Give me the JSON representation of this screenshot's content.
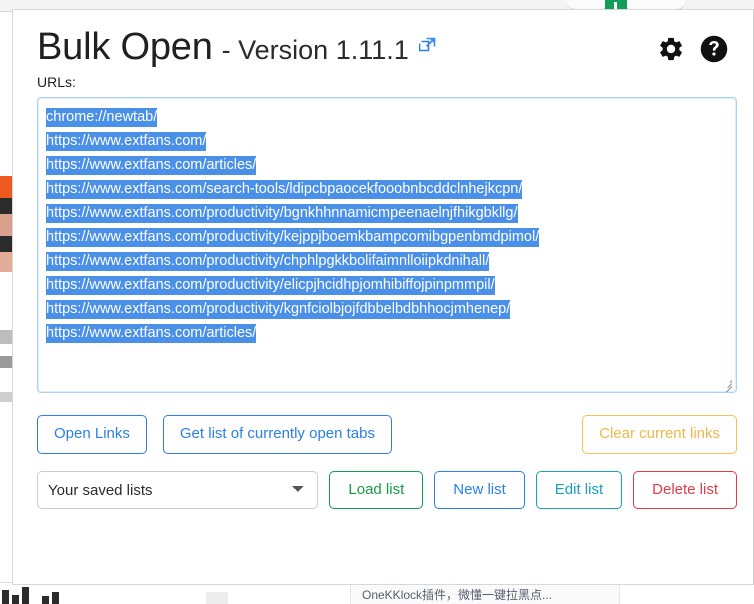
{
  "background": {
    "bottom_card_text": "OneKKlock插件，微懂一键拉黑点..."
  },
  "popup": {
    "title": "Bulk Open",
    "version": "- Version 1.11.1",
    "external_link_icon": "external-link-icon",
    "settings_icon": "gear-icon",
    "help_icon": "help-circle-icon",
    "urls_label": "URLs:",
    "textarea": {
      "placeholder": "",
      "all_selected": true,
      "lines": [
        "chrome://newtab/",
        "https://www.extfans.com/",
        "https://www.extfans.com/articles/",
        "https://www.extfans.com/search-tools/ldipcbpaocekfooobnbcddclnhejkcpn/",
        "https://www.extfans.com/productivity/bgnkhhnnamicmpeenaelnjfhikgbkllg/",
        "https://www.extfans.com/productivity/kejppjboemkbampcomibgpenbmdpimol/",
        "https://www.extfans.com/productivity/chphlpgkkbolifaimnlloiipkdnihall/",
        "https://www.extfans.com/productivity/elicpjhcidhpjomhibiffojpinpmmpil/",
        "https://www.extfans.com/productivity/kgnfciolbjojfdbbelbdbhhocjmhenep/",
        "https://www.extfans.com/articles/"
      ]
    },
    "actions": {
      "open_links": "Open Links",
      "get_open_tabs": "Get list of currently open tabs",
      "clear_links": "Clear current links"
    },
    "saved_lists": {
      "selected": "Your saved lists",
      "options": [
        "Your saved lists"
      ],
      "load": "Load list",
      "new": "New list",
      "edit": "Edit list",
      "delete": "Delete list"
    },
    "colors": {
      "primary_blue": "#2a7fe8",
      "selection_blue": "#4a90e8",
      "amber": "#f0b84b",
      "green": "#159b47",
      "teal": "#1ba0b8",
      "red": "#e23b49",
      "badge_green": "#0f9d58"
    }
  }
}
